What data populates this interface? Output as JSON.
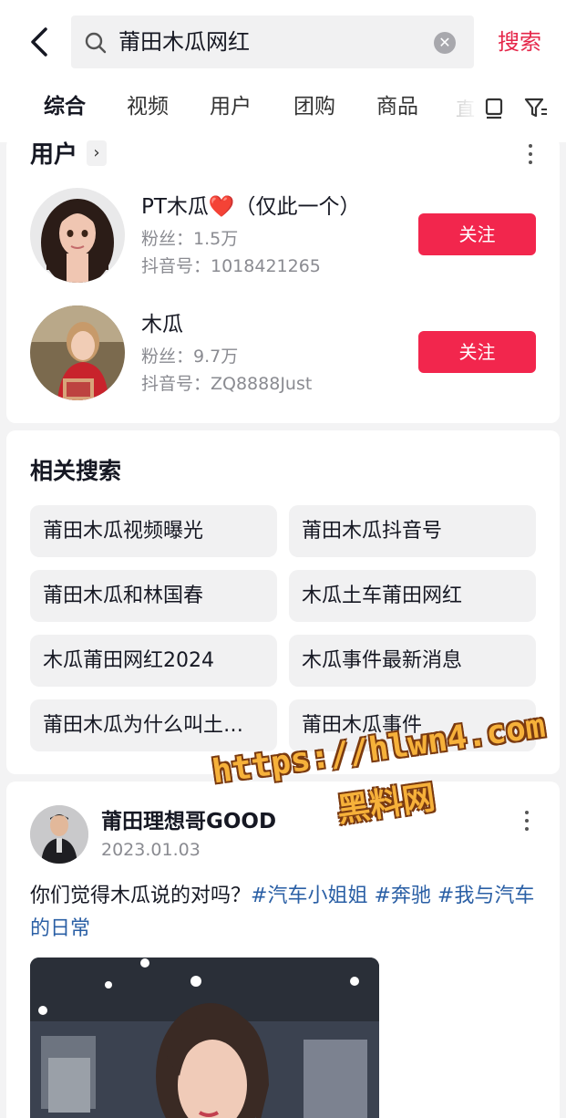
{
  "colors": {
    "accent": "#f2264d",
    "search_text": "#e5274a",
    "tag": "#2a5fa5",
    "watermark": "#f6b13a"
  },
  "search": {
    "query": "莆田木瓜网红",
    "submit_label": "搜索"
  },
  "tabs": [
    {
      "label": "综合",
      "active": true
    },
    {
      "label": "视频"
    },
    {
      "label": "用户"
    },
    {
      "label": "团购"
    },
    {
      "label": "商品"
    },
    {
      "label": "直"
    }
  ],
  "users": {
    "title": "用户",
    "items": [
      {
        "name": "PT木瓜❤️（仅此一个）",
        "fans": "粉丝：1.5万",
        "id": "抖音号：1018421265",
        "follow": "关注"
      },
      {
        "name": "木瓜",
        "fans": "粉丝：9.7万",
        "id": "抖音号：ZQ8888Just",
        "follow": "关注"
      }
    ]
  },
  "related": {
    "title": "相关搜索",
    "items": [
      "莆田木瓜视频曝光",
      "莆田木瓜抖音号",
      "莆田木瓜和林国春",
      "木瓜土车莆田网红",
      "木瓜莆田网红2024",
      "木瓜事件最新消息",
      "莆田木瓜为什么叫土…",
      "莆田木瓜事件"
    ]
  },
  "post": {
    "author": "莆田理想哥GOOD",
    "date": "2023.01.03",
    "text": "你们觉得木瓜说的对吗？",
    "tags": [
      "#汽车小姐姐",
      "#奔驰",
      "#我与汽车的日常"
    ]
  },
  "watermark": {
    "line1": "https://hlwn4.com",
    "line2": "黑料网"
  }
}
